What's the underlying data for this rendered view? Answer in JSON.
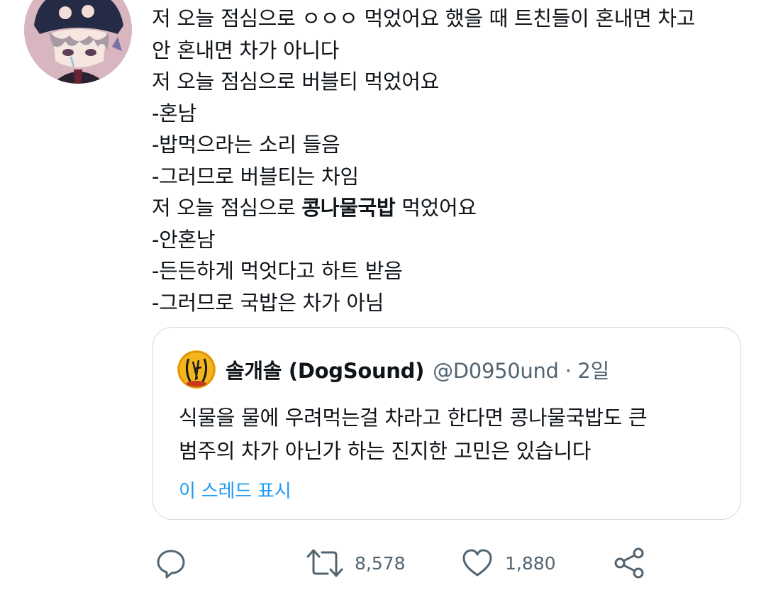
{
  "tweet": {
    "lines": [
      "저 오늘 점심으로 ㅇㅇㅇ 먹었어요 했을 때 트친들이 혼내면 차고",
      "안 혼내면 차가 아니다",
      "저 오늘 점심으로 버블티 먹었어요",
      "-혼남",
      "-밥먹으라는 소리 들음",
      "-그러므로 버블티는 차임"
    ],
    "line7_before": "저 오늘 점심으로 ",
    "line7_bold": "콩나물국밥",
    "line7_after": " 먹었어요",
    "lines_end": [
      "-안혼남",
      "-든든하게 먹엇다고 하트 받음",
      "-그러므로 국밥은 차가 아님"
    ]
  },
  "quote": {
    "name": "솔개솔 (DogSound)",
    "handle": "@D0950und · 2일",
    "avatar_icon": "dogsound-avatar",
    "text": [
      "식물을 물에 우려먹는걸 차라고 한다면 콩나물국밥도 큰",
      "범주의 차가 아닌가 하는 진지한 고민은 있습니다"
    ],
    "show_thread": "이 스레드 표시"
  },
  "actions": {
    "reply_icon": "reply-icon",
    "retweet_icon": "retweet-icon",
    "retweet_count": "8,578",
    "like_icon": "heart-icon",
    "like_count": "1,880",
    "share_icon": "share-icon"
  },
  "colors": {
    "text": "#0f1419",
    "secondary": "#536471",
    "link": "#1d9bf0",
    "border": "#cfd9de"
  }
}
